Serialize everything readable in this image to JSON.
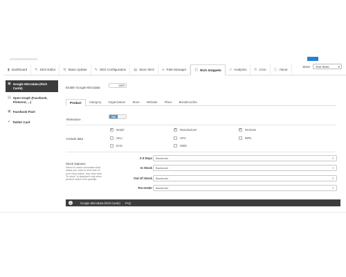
{
  "nav": {
    "tabs": [
      {
        "label": "Dashboard",
        "icon": "dashboard-icon",
        "glyph": "▮"
      },
      {
        "label": "SEO Editor",
        "icon": "edit-icon",
        "glyph": "✎"
      },
      {
        "label": "Mass Update",
        "icon": "mass-update-icon",
        "glyph": "⇅"
      },
      {
        "label": "SEO Configuration",
        "icon": "wrench-icon",
        "glyph": "✎"
      },
      {
        "label": "Store SEO",
        "icon": "store-icon",
        "glyph": "▤"
      },
      {
        "label": "Path Manager",
        "icon": "link-icon",
        "glyph": "∞"
      },
      {
        "label": "Rich Snippets",
        "icon": "snippet-icon",
        "glyph": "◰"
      },
      {
        "label": "Analytics",
        "icon": "analytics-icon",
        "glyph": "↗"
      },
      {
        "label": "Cron",
        "icon": "cron-icon",
        "glyph": "↻"
      },
      {
        "label": "About",
        "icon": "info-icon",
        "glyph": "ⓘ"
      }
    ],
    "active_index": 6,
    "store_label": "Store",
    "store_value": "Your Store"
  },
  "sidebar": {
    "items": [
      {
        "label": "Google Microdata (Rich Cards)",
        "icon": "microdata-icon",
        "glyph": "▣"
      },
      {
        "label": "Open Graph (Facebook, Pinterest, ...)",
        "icon": "opengraph-icon",
        "glyph": "▤"
      },
      {
        "label": "Facebook Pixel",
        "icon": "facebook-icon",
        "glyph": "▣"
      },
      {
        "label": "Twitter Card",
        "icon": "twitter-icon",
        "glyph": "✔"
      }
    ],
    "active_index": 0
  },
  "main": {
    "enable_label": "Enable Google Microdata",
    "enable_toggle": {
      "left": "",
      "right": "OFF"
    },
    "subtabs": [
      "Product",
      "Category",
      "Organization",
      "Store",
      "Website",
      "Place",
      "Breadcrumbs"
    ],
    "active_subtab": 0,
    "rel_label": "Relevance",
    "rel_toggle": {
      "left": "ON",
      "right": ""
    },
    "include_label": "Include data",
    "checkboxes": [
      {
        "label": "Model",
        "checked": true
      },
      {
        "label": "Manufacturer",
        "checked": true
      },
      {
        "label": "Reviews",
        "checked": true
      },
      {
        "label": "SKU",
        "checked": false
      },
      {
        "label": "UPC",
        "checked": false
      },
      {
        "label": "MPN",
        "checked": false
      },
      {
        "label": "EAN",
        "checked": false
      },
      {
        "label": "ISBN",
        "checked": false
      }
    ],
    "stock": {
      "title": "Stock statuses",
      "description": "Select to which microdata stock status you want to bind each of your stock status, any other than \"In stock\" is displayed only when product match zero quantity",
      "rows": [
        {
          "label": "2-3 Days",
          "value": "Backorder"
        },
        {
          "label": "In Stock",
          "value": "Backorder"
        },
        {
          "label": "Out Of Stock",
          "value": "Backorder"
        },
        {
          "label": "Pre-Order",
          "value": "Backorder"
        }
      ]
    }
  },
  "footer": {
    "info_glyph": "i",
    "title": "Google Microdata (Rich Cards)",
    "faq": "FAQ"
  }
}
